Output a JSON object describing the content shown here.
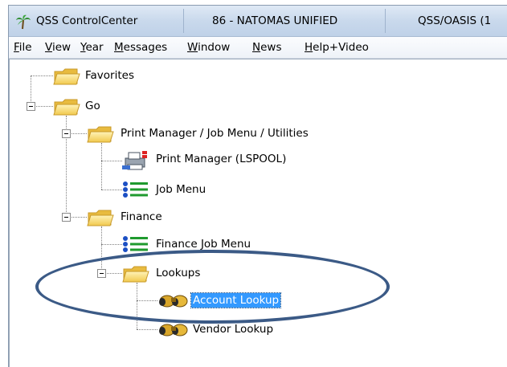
{
  "window": {
    "app_title": "QSS ControlCenter",
    "district": "86 - NATOMAS UNIFIED",
    "system": "QSS/OASIS (1"
  },
  "menu": [
    {
      "label": "File",
      "ul": "F",
      "rest": "ile"
    },
    {
      "label": "View",
      "ul": "V",
      "rest": "iew"
    },
    {
      "label": "Year",
      "ul": "Y",
      "rest": "ear"
    },
    {
      "label": "Messages",
      "ul": "M",
      "rest": "essages"
    },
    {
      "label": "Window",
      "ul": "W",
      "rest": "indow"
    },
    {
      "label": "News",
      "ul": "N",
      "rest": "ews"
    },
    {
      "label": "Help+Video",
      "ul": "H",
      "rest": "elp+Video"
    }
  ],
  "tree": {
    "favorites": "Favorites",
    "go": "Go",
    "print_job_utilities": "Print Manager / Job Menu / Utilities",
    "print_manager": "Print Manager (LSPOOL)",
    "job_menu": "Job Menu",
    "finance": "Finance",
    "finance_job_menu": "Finance Job Menu",
    "lookups": "Lookups",
    "account_lookup": "Account Lookup",
    "vendor_lookup": "Vendor Lookup"
  },
  "colors": {
    "selection": "#3399ff",
    "annotation_ellipse": "#3b5a86",
    "folder": "#f5d36b"
  },
  "icons": {
    "app": "palm-tree-icon",
    "folder": "folder-icon",
    "printer": "printer-icon",
    "job_menu": "bullet-list-icon",
    "lookup": "binoculars-icon"
  }
}
